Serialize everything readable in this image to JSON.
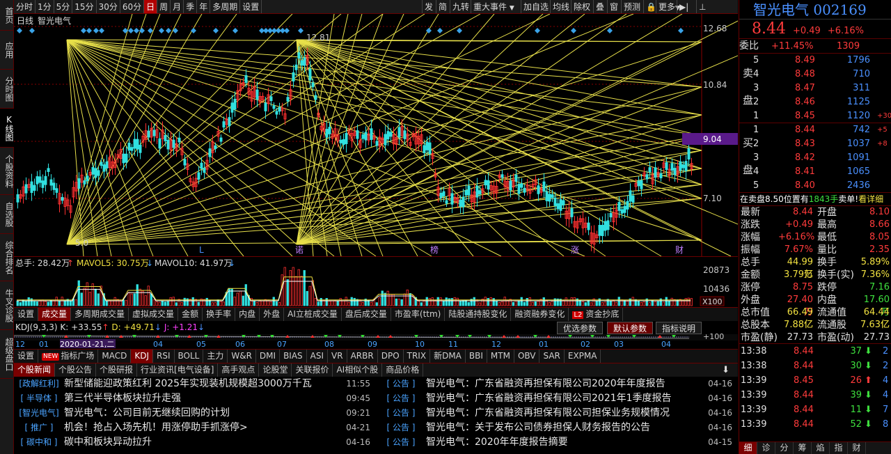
{
  "sidebar": [
    "首页",
    "应用",
    "分时图",
    "K线图",
    "个股资料",
    "自选股",
    "综合排名",
    "牛叉诊股",
    "超级盘口"
  ],
  "topbar": {
    "periods": [
      "分时",
      "1分",
      "5分",
      "15分",
      "30分",
      "60分",
      "日",
      "周",
      "月",
      "季",
      "年",
      "多周期",
      "设置"
    ],
    "active_period": "日",
    "right_buttons": [
      "发",
      "简",
      "九转",
      "重大事件",
      "加自选",
      "均线",
      "除权",
      "叠",
      "窗",
      "预测",
      "更多"
    ]
  },
  "chart": {
    "label_period": "日线",
    "label_name": "智光电气",
    "price_axis": [
      "12.68",
      "10.84",
      "9.04",
      "7.10"
    ],
    "current_price_tag": "9.04",
    "high_label": "12.81",
    "low_label": "5.0",
    "markers": [
      "L",
      "诺",
      "榜",
      "涨",
      "财"
    ]
  },
  "volume": {
    "total_label": "总手: 28.42万",
    "mavol5": "MAVOL5: 30.75万",
    "mavol10": "MAVOL10: 41.97万",
    "axis": [
      "20873",
      "10436"
    ],
    "unit": "X100"
  },
  "indicator_tabs": [
    "设置",
    "成交量",
    "多周期成交量",
    "虚拟成交量",
    "金额",
    "换手率",
    "内盘",
    "外盘",
    "AI立桩成交量",
    "盘后成交量",
    "市盈率(ttm)",
    "陆股通持股变化",
    "融资融券变化",
    "资金抄底"
  ],
  "indicator_tabs_active": "成交量",
  "l2_badge": "L2",
  "kdj": {
    "name": "KDJ(9,3,3)",
    "k": "K: +33.55",
    "d": "D: +49.71",
    "j": "J: +1.21",
    "buttons": [
      "优选参数",
      "默认参数",
      "指标说明"
    ],
    "active_button": "默认参数",
    "axis": "+100",
    "months": [
      "12",
      "01",
      "2020-01-21,二",
      "04",
      "05",
      "06",
      "07",
      "08",
      "09",
      "10",
      "11",
      "12",
      "01",
      "02",
      "03",
      "04"
    ]
  },
  "ind_tabs": [
    "设置",
    "指标广场",
    "MACD",
    "KDJ",
    "RSI",
    "BOLL",
    "主力",
    "W&R",
    "DMI",
    "BIAS",
    "ASI",
    "VR",
    "ARBR",
    "DPO",
    "TRIX",
    "新DMA",
    "BBI",
    "MTM",
    "OBV",
    "SAR",
    "EXPMA"
  ],
  "ind_tabs_active": "KDJ",
  "new_badge": "NEW",
  "news_tabs": [
    "个股新闻",
    "个股公告",
    "个股研报",
    "行业资讯[电气设备]",
    "高手观点",
    "论股堂",
    "关联报价",
    "AI相似个股",
    "商品价格"
  ],
  "news_tabs_active": "个股新闻",
  "news_left": [
    {
      "tag": "[政解红利]",
      "title": "新型储能迎政策红利 2025年实现装机规模超3000万千瓦",
      "date": "11:55"
    },
    {
      "tag": "[ 半导体 ]",
      "title": "第三代半导体板块拉升走强",
      "date": "09:45"
    },
    {
      "tag": "[智光电气]",
      "title": "智光电气：公司目前无继续回购的计划",
      "date": "09:21"
    },
    {
      "tag": "[ 推广 ]",
      "title": "机会！抢占入场先机！用涨停助手抓涨停>",
      "date": "04-21"
    },
    {
      "tag": "[ 碳中和 ]",
      "title": "碳中和板块异动拉升",
      "date": "04-16"
    }
  ],
  "news_right": [
    {
      "tag": "[ 公告 ]",
      "title": "智光电气：广东省融资再担保有限公司2020年年度报告",
      "date": "04-16"
    },
    {
      "tag": "[ 公告 ]",
      "title": "智光电气：广东省融资再担保有限公司2021年1季度报告",
      "date": "04-16"
    },
    {
      "tag": "[ 公告 ]",
      "title": "智光电气：广东省融资再担保有限公司担保业务规模情况",
      "date": "04-16"
    },
    {
      "tag": "[ 公告 ]",
      "title": "智光电气：关于发布公司债券担保人财务报告的公告",
      "date": "04-16"
    },
    {
      "tag": "[ 公告 ]",
      "title": "智光电气：2020年年度报告摘要",
      "date": "04-15"
    }
  ],
  "quote": {
    "name": "智光电气",
    "code": "002169",
    "price": "8.44",
    "change": "+0.49",
    "pct": "+6.16%",
    "weibi_label": "委比",
    "weibi": "+11.45%",
    "weicha": "1309",
    "sell_label": "卖盘",
    "buy_label": "买盘",
    "asks": [
      {
        "n": "5",
        "p": "8.49",
        "v": "1796",
        "d": ""
      },
      {
        "n": "4",
        "p": "8.48",
        "v": "710",
        "d": ""
      },
      {
        "n": "3",
        "p": "8.47",
        "v": "311",
        "d": ""
      },
      {
        "n": "2",
        "p": "8.46",
        "v": "1125",
        "d": ""
      },
      {
        "n": "1",
        "p": "8.45",
        "v": "1120",
        "d": "+30"
      }
    ],
    "bids": [
      {
        "n": "1",
        "p": "8.44",
        "v": "742",
        "d": "+5"
      },
      {
        "n": "2",
        "p": "8.43",
        "v": "1037",
        "d": "+8"
      },
      {
        "n": "3",
        "p": "8.42",
        "v": "1091",
        "d": ""
      },
      {
        "n": "4",
        "p": "8.41",
        "v": "1065",
        "d": ""
      },
      {
        "n": "5",
        "p": "8.40",
        "v": "2436",
        "d": ""
      }
    ],
    "notice_a": "在卖盘8.50位置有",
    "notice_b": "1843手",
    "notice_c": "卖单!",
    "notice_d": "看详细",
    "stats": [
      [
        "最新",
        "8.44",
        "开盘",
        "8.10"
      ],
      [
        "涨跌",
        "+0.49",
        "最高",
        "8.66"
      ],
      [
        "涨幅",
        "+6.16%",
        "最低",
        "8.05"
      ],
      [
        "振幅",
        "7.67%",
        "量比",
        "2.35"
      ],
      [
        "总手",
        "44.99万",
        "换手",
        "5.89%"
      ],
      [
        "金额",
        "3.79亿",
        "换手(实)",
        "7.36%"
      ],
      [
        "涨停",
        "8.75",
        "跌停",
        "7.16"
      ],
      [
        "外盘",
        "27.40万",
        "内盘",
        "17.60万"
      ],
      [
        "总市值",
        "66.49亿",
        "流通值",
        "64.44亿"
      ],
      [
        "总股本",
        "7.88亿",
        "流通股",
        "7.63亿"
      ],
      [
        "市盈(静)",
        "27.73",
        "市盈(动)",
        "27.73"
      ]
    ],
    "ticks": [
      {
        "t": "13:38",
        "p": "8.44",
        "v": "37",
        "dir": "down",
        "n": "2"
      },
      {
        "t": "13:38",
        "p": "8.44",
        "v": "30",
        "dir": "down",
        "n": "2"
      },
      {
        "t": "13:39",
        "p": "8.45",
        "v": "26",
        "dir": "up",
        "n": "4"
      },
      {
        "t": "13:39",
        "p": "8.44",
        "v": "39",
        "dir": "down",
        "n": "4"
      },
      {
        "t": "13:39",
        "p": "8.44",
        "v": "11",
        "dir": "down",
        "n": "7"
      },
      {
        "t": "13:39",
        "p": "8.44",
        "v": "52",
        "dir": "down",
        "n": "8"
      }
    ],
    "bottom_tabs": [
      "细",
      "诊",
      "分",
      "筹",
      "焰",
      "指",
      "财"
    ]
  }
}
